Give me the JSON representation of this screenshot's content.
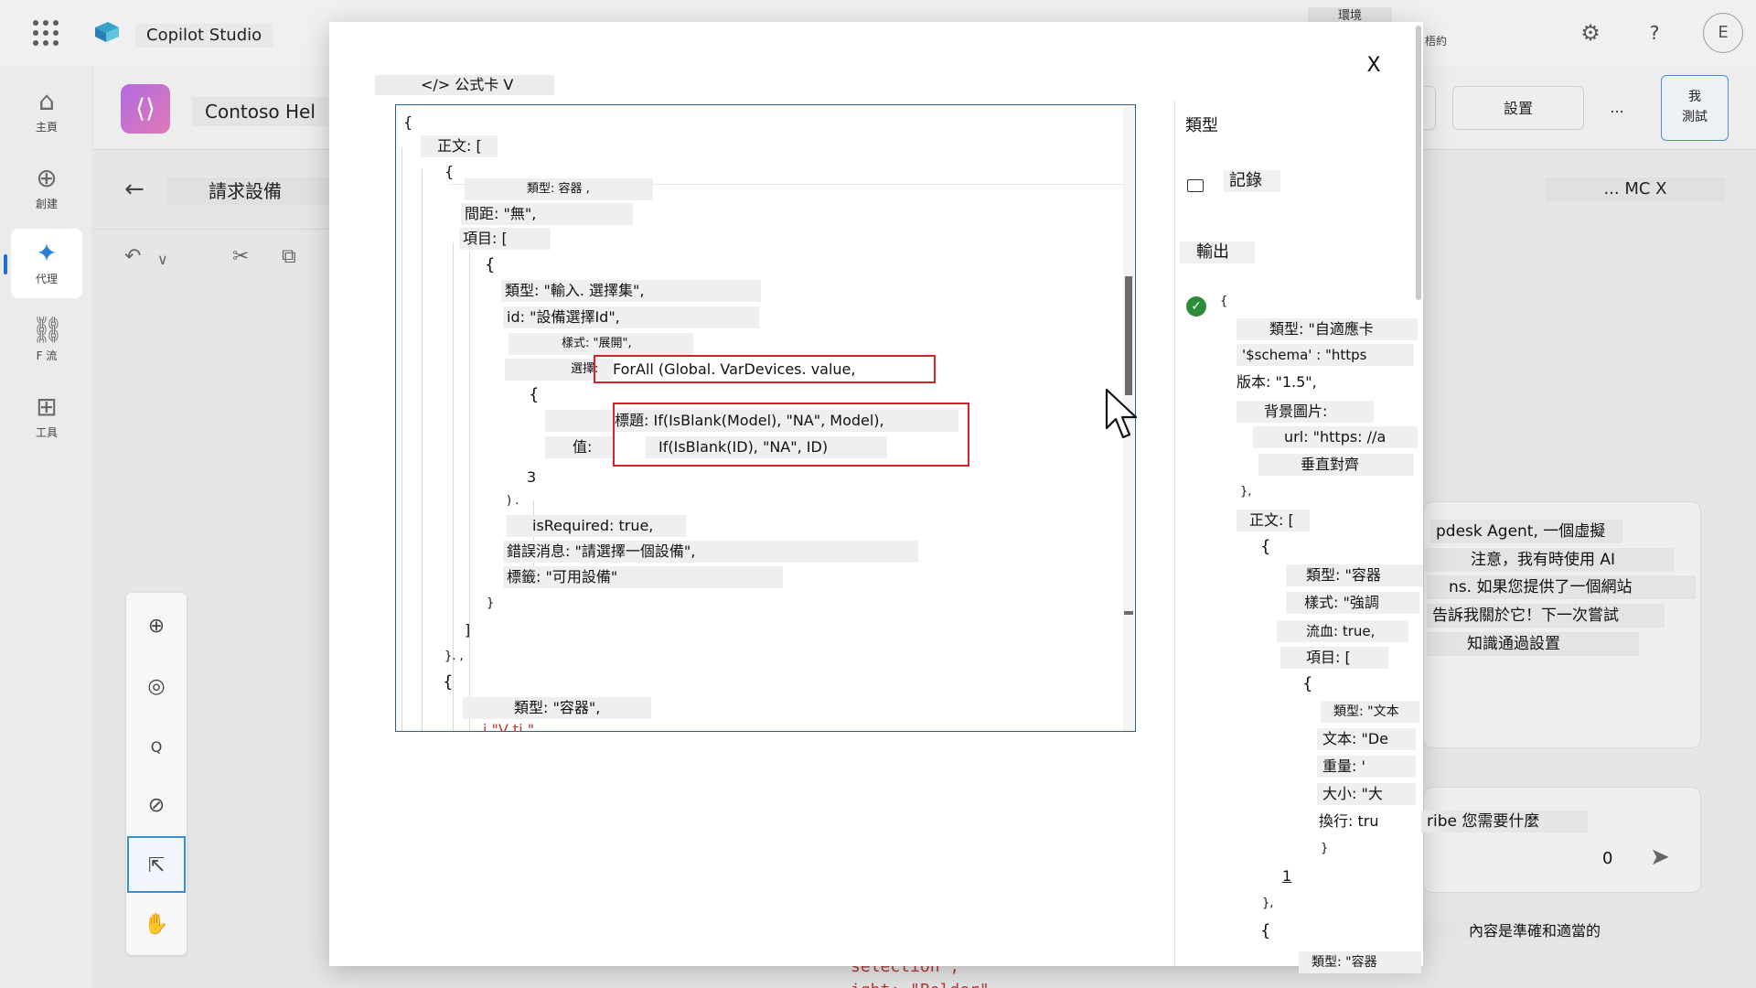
{
  "app": {
    "name": "Copilot Studio",
    "env_label": "環境",
    "env_sub": "梧約",
    "avatar_initial": "E",
    "gear_glyph": "⚙",
    "help_glyph": "?"
  },
  "rail": [
    {
      "name": "home",
      "label": "主頁",
      "glyph": "⌂"
    },
    {
      "name": "create",
      "label": "創建",
      "glyph": "⊕"
    },
    {
      "name": "agents",
      "label": "代理",
      "glyph": "✦"
    },
    {
      "name": "flows",
      "label": "F 流",
      "glyph": "⛓"
    },
    {
      "name": "tools",
      "label": "工具",
      "glyph": "⊞"
    }
  ],
  "agent": {
    "name": "Contoso Hel",
    "topic_title": "請求設備"
  },
  "header_buttons": {
    "settings": "設置",
    "more": "...",
    "test_line1": "我",
    "test_line2": "測試"
  },
  "chat": {
    "header": "... MC X",
    "lines": [
      "pdesk Agent, 一個虛擬",
      "注意，我有時使用 AI",
      "ns. 如果您提供了一個網站",
      "告訴我關於它！下一次嘗試",
      "知識通過設置"
    ],
    "ask": "ribe 您需要什麼",
    "count": "0",
    "footer": "內容是準確和適當的"
  },
  "bg_code": {
    "line1": "selection\",",
    "line2": "  ight: \"Bolder\""
  },
  "modal": {
    "title": "</> 公式卡 V",
    "close_label": "X",
    "editor_lines": [
      "{",
      "正文: [",
      "{",
      "類型: 容器 ,",
      "間距: \"無\",",
      "項目: [",
      "{",
      "類型: \"輸入. 選擇集\",",
      "id: \"設備選擇Id\",",
      "樣式: \"展開\",",
      "選擇: ",
      "ForAll (Global. VarDevices. value,",
      "{",
      "標題: If(IsBlank(Model), \"NA\", Model),",
      "值:",
      "If(IsBlank(ID), \"NA\", ID)",
      "3",
      ") .",
      "isRequired: true,",
      "錯誤消息: \"請選擇一個設備\",",
      "標籤: \"可用設備\"",
      "}",
      "]",
      "}. ,",
      "{",
      "類型: \"容器\",",
      "  i  \"V  ti  \""
    ],
    "side": {
      "type_label": "類型",
      "record_label": "記錄",
      "output_label": "輸出",
      "output_lines": [
        "{",
        "類型: \"自適應卡",
        "'$schema' : \"https",
        "版本: \"1.5\",",
        "背景圖片:",
        "url: \"https: //a",
        "垂直對齊",
        "},",
        "正文: [",
        "{",
        "類型: \"容器",
        "樣式: \"強調",
        "流血: true,",
        "項目: [",
        "{",
        "類型: \"文本",
        "文本: \"De",
        "重量: '",
        "大小: \"大",
        "換行: tru",
        "}",
        "1",
        "},",
        "{",
        "類型: \"容器"
      ]
    }
  }
}
